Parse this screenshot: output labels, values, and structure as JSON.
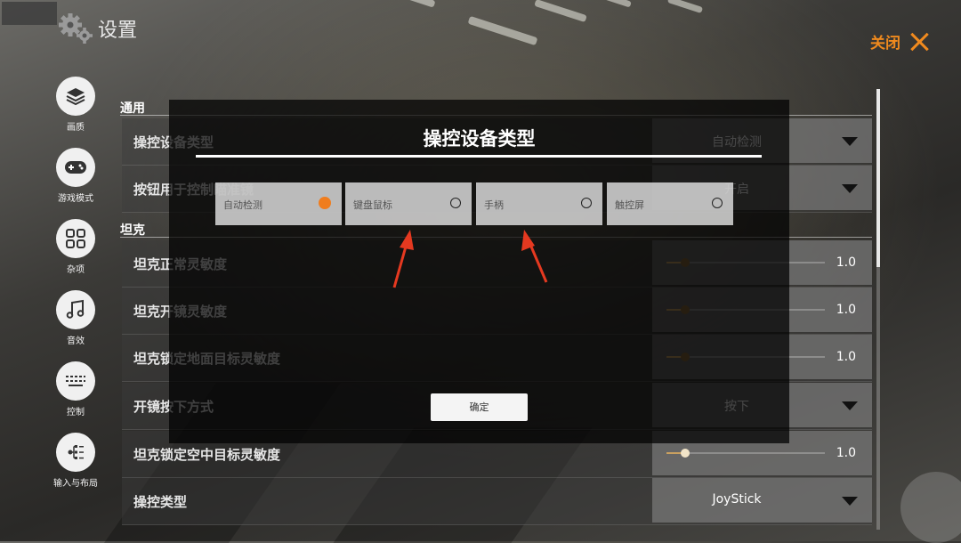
{
  "header": {
    "title": "设置"
  },
  "close": {
    "label": "关闭"
  },
  "sidebar": {
    "items": [
      {
        "label": "画质",
        "icon": "layers-icon"
      },
      {
        "label": "游戏模式",
        "icon": "gamepad-icon"
      },
      {
        "label": "杂项",
        "icon": "grid-icon"
      },
      {
        "label": "音效",
        "icon": "music-note-icon"
      },
      {
        "label": "控制",
        "icon": "keyboard-icon"
      },
      {
        "label": "输入与布局",
        "icon": "tree-icon"
      }
    ]
  },
  "sections": {
    "general": "通用",
    "tank": "坦克"
  },
  "rows": {
    "device_type": {
      "label": "操控设备类型",
      "value": "自动检测"
    },
    "button_control": {
      "label": "按钮用于控制瞄准镜",
      "value": "开启"
    },
    "tank_normal": {
      "label": "坦克正常灵敏度",
      "value": "1.0",
      "fraction": 0.12
    },
    "tank_scope": {
      "label": "坦克开镜灵敏度",
      "value": "1.0",
      "fraction": 0.12
    },
    "tank_ground_lock": {
      "label": "坦克锁定地面目标灵敏度",
      "value": "1.0",
      "fraction": 0.12
    },
    "scope_mode": {
      "label": "开镜按下方式",
      "value": "按下"
    },
    "tank_air_lock": {
      "label": "坦克锁定空中目标灵敏度",
      "value": "1.0",
      "fraction": 0.12
    },
    "control_type": {
      "label": "操控类型",
      "value": "JoyStick"
    }
  },
  "modal": {
    "title": "操控设备类型",
    "options": [
      {
        "label": "自动检测",
        "selected": true
      },
      {
        "label": "键盘鼠标",
        "selected": false
      },
      {
        "label": "手柄",
        "selected": false
      },
      {
        "label": "触控屏",
        "selected": false
      }
    ],
    "confirm": "确定"
  },
  "colors": {
    "accent": "#f07d1e",
    "close": "#f08a1e",
    "annotation_arrow": "#e53920"
  }
}
